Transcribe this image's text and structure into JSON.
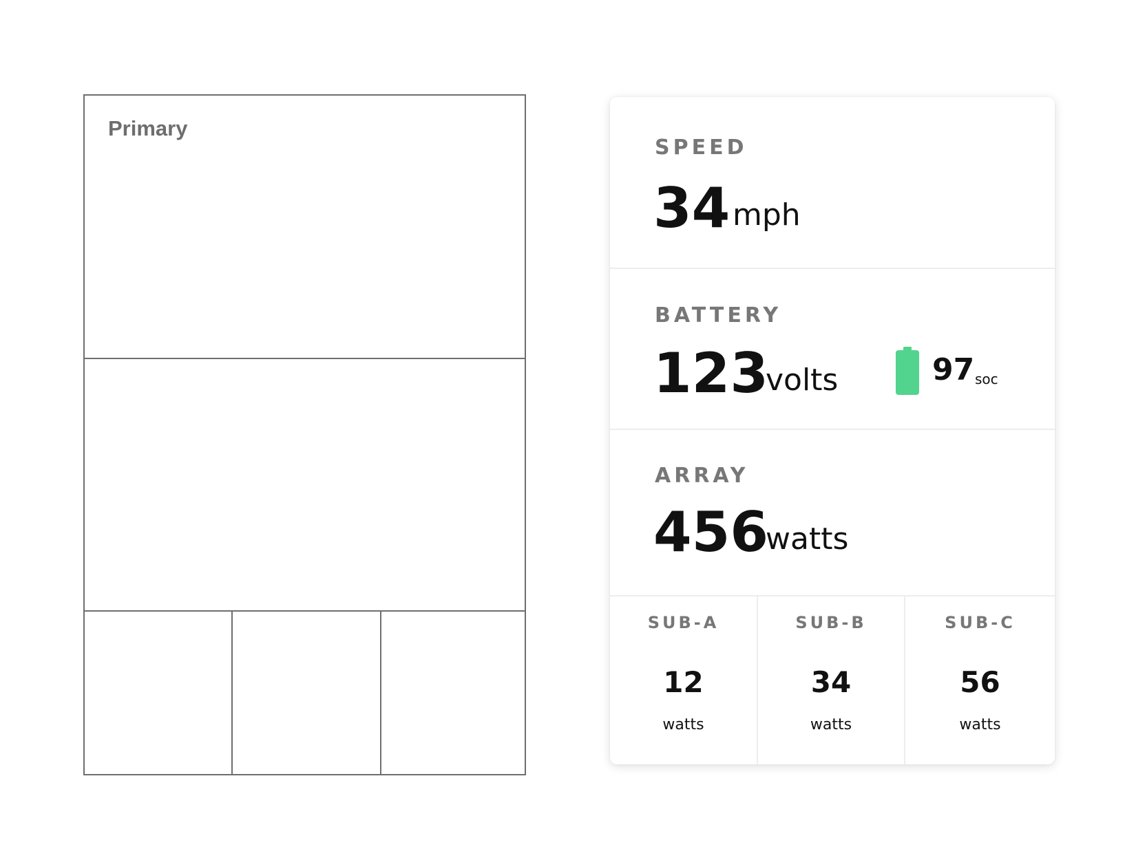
{
  "wireframe": {
    "primary_label": "Primary"
  },
  "dashboard": {
    "speed": {
      "label": "SPEED",
      "value": "34",
      "unit": "mph"
    },
    "battery": {
      "label": "BATTERY",
      "value": "123",
      "unit": "volts",
      "soc_value": "97",
      "soc_unit": "soc",
      "icon": "battery-full-icon",
      "icon_color": "#52d48e"
    },
    "array": {
      "label": "ARRAY",
      "value": "456",
      "unit": "watts"
    },
    "subs": [
      {
        "label": "SUB-A",
        "value": "12",
        "unit": "watts"
      },
      {
        "label": "SUB-B",
        "value": "34",
        "unit": "watts"
      },
      {
        "label": "SUB-C",
        "value": "56",
        "unit": "watts"
      }
    ]
  }
}
